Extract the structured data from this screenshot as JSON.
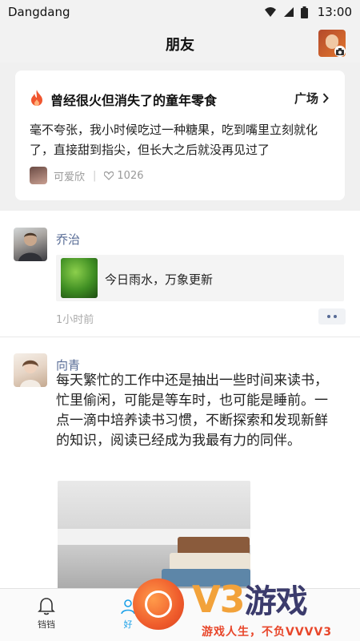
{
  "status_bar": {
    "carrier": "Dangdang",
    "time": "13:00"
  },
  "header": {
    "title": "朋友"
  },
  "topic_card": {
    "title": "曾经很火但消失了的童年零食",
    "link_label": "广场",
    "body": "毫不夸张，我小时候吃过一种糖果，吃到嘴里立刻就化了，直接甜到指尖，但长大之后就没再见过了",
    "author": "可爱欣",
    "likes": "1026",
    "icons": {
      "topic": "fire-icon",
      "link": "chevron-right-icon",
      "likes": "heart-outline-icon"
    }
  },
  "posts": [
    {
      "name": "乔治",
      "shared_text": "今日雨水，万象更新",
      "time": "1小时前"
    },
    {
      "name": "向青",
      "text": "每天繁忙的工作中还是抽出一些时间来读书，忙里偷闲，可能是等车时，也可能是睡前。一点一滴中培养读书习惯，不断探索和发现新鲜的知识，阅读已经成为我最有力的同伴。"
    }
  ],
  "tab_bar": {
    "tabs": [
      {
        "label": "铛铛",
        "icon": "bell-icon"
      },
      {
        "label": "好",
        "icon": "friends-icon"
      }
    ]
  },
  "watermark": {
    "logo_v3": "V3",
    "logo_text": "游戏",
    "slogan": "游戏人生，不负VVVV3"
  },
  "colors": {
    "name_link": "#576b95",
    "active_tab": "#1aa0e8",
    "fire": "#f0562f",
    "watermark_orange": "#f08a26",
    "watermark_red": "#e8462a"
  }
}
